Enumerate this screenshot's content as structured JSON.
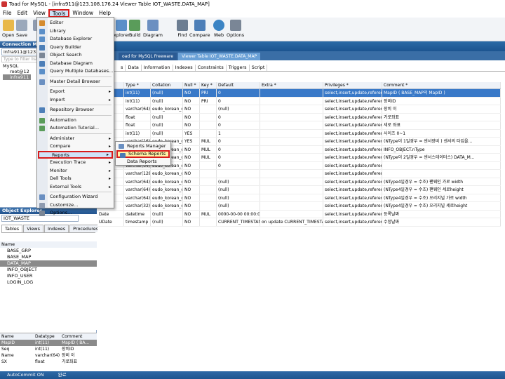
{
  "window": {
    "title": "Toad for MySQL - [infra911@123.108.176.24 Viewer Table IOT_WASTE.DATA_MAP]"
  },
  "menubar": {
    "items": [
      "File",
      "Edit",
      "View",
      "Tools",
      "Window",
      "Help"
    ]
  },
  "toolbar": {
    "buttons": [
      "Open",
      "Save",
      "Pr",
      "xplorer",
      "Build",
      "Diagram",
      "Find",
      "Compare",
      "Web",
      "Options"
    ]
  },
  "connection_manager": {
    "title": "Connection Mana",
    "connection": "infra911@123.108.",
    "filter_placeholder": "Type to filter list",
    "tree": [
      "MySQL",
      "root@12",
      "infra911"
    ]
  },
  "doc_tabs": [
    "oad for MySQL Freeware",
    "Viewer Table IOT_WASTE.DATA_MAP"
  ],
  "sub_tabs": [
    "s",
    "Data",
    "Information",
    "Indexes",
    "Constraints",
    "Triggers",
    "Script"
  ],
  "tools_menu": {
    "items": [
      "Editor",
      "Library",
      "Database Explorer",
      "Query Builder",
      "Object Search",
      "Database Diagram",
      "Query Multiple Databases...",
      "Master Detail Browser",
      "Export",
      "Import",
      "Repository Browser",
      "Automation",
      "Automation Tutorial...",
      "Administer",
      "Compare",
      "Reports",
      "Execution Trace",
      "Monitor",
      "Dell Tools",
      "External Tools",
      "Configuration Wizard",
      "Customize...",
      "Options..."
    ]
  },
  "reports_submenu": {
    "items": [
      "Reports Manager",
      "Schema Reports",
      "Data Reports"
    ]
  },
  "object_explorer": {
    "title": "Object Explorer",
    "schema": "IOT_WASTE",
    "tabs": [
      "Tables",
      "Views",
      "Indexes",
      "Procedures"
    ],
    "list_header": "Name",
    "tables": [
      "BASE_GRP",
      "BASE_MAP",
      "DATA_MAP",
      "INFO_OBJECT",
      "INFO_USER",
      "LOGIN_LOG"
    ]
  },
  "columns_grid": {
    "headers": [
      "Name",
      "Datatype",
      "Comment"
    ],
    "rows": [
      [
        "MapID",
        "int(11)",
        "MapID ( BA..."
      ],
      [
        "Seq",
        "int(11)",
        "장비ID"
      ],
      [
        "Name",
        "varchar(64)",
        "장비 이"
      ],
      [
        "SX",
        "float",
        "가로좌표"
      ]
    ]
  },
  "grid": {
    "headers": [
      "ID *",
      "Type *",
      "Collation",
      "Null *",
      "Key *",
      "Default",
      "Extra *",
      "Privileges *",
      "Comment *"
    ],
    "rows": [
      [
        "D",
        "int(11)",
        "(null)",
        "NO",
        "PRI",
        "0",
        "",
        "select,insert,update,references",
        "MapID ( BASE_MAP의 MapID )"
      ],
      [
        "",
        "int(11)",
        "(null)",
        "NO",
        "PRI",
        "0",
        "",
        "select,insert,update,references",
        "장비ID"
      ],
      [
        "e",
        "varchar(64)",
        "eudo_korean_ci",
        "NO",
        "",
        "(null)",
        "",
        "select,insert,update,references",
        "장비 이"
      ],
      [
        "",
        "float",
        "(null)",
        "NO",
        "",
        "0",
        "",
        "select,insert,update,references",
        "가로좌표"
      ],
      [
        "",
        "float",
        "(null)",
        "NO",
        "",
        "0",
        "",
        "select,insert,update,references",
        "세로 좌표"
      ],
      [
        "",
        "int(11)",
        "(null)",
        "YES",
        "",
        "1",
        "",
        "select,insert,update,references",
        "사이즈 0~1"
      ],
      [
        "e",
        "varchar(16)",
        "eudo_korean_ci",
        "YES",
        "MUL",
        "0",
        "",
        "select,insert,update,references",
        "(NType이 1일경우 = 센서장비 ) 센서의 타입을..."
      ],
      [
        "",
        "varchar(64)",
        "eudo_korean_ci",
        "NO",
        "MUL",
        "0",
        "",
        "select,insert,update,references",
        "INFO_OBJECT.nType"
      ],
      [
        "",
        "varchar(64)",
        "eudo_korean_ci",
        "NO",
        "MUL",
        "0",
        "",
        "select,insert,update,references",
        "(NType이 2일경우 = 센서스테이터스) DATA_M..."
      ],
      [
        "",
        "varchar(64)",
        "eudo_korean_ci",
        "NO",
        "",
        "0",
        "",
        "select,insert,update,references",
        ""
      ],
      [
        "str",
        "varchar(128)",
        "eudo_korean_ci",
        "NO",
        "",
        "",
        "",
        "select,insert,update,references",
        ""
      ],
      [
        "ht1",
        "varchar(64)",
        "eudo_korean_ci",
        "NO",
        "",
        "(null)",
        "",
        "select,insert,update,references",
        "(NType4일경우 = 수조) 팬웨인 가로 width"
      ],
      [
        "ht2",
        "varchar(64)",
        "eudo_korean_ci",
        "NO",
        "",
        "(null)",
        "",
        "select,insert,update,references",
        "(NType4일경우 = 수조) 팬웨인 세로height"
      ],
      [
        "ht3",
        "varchar(64)",
        "eudo_korean_ci",
        "NO",
        "",
        "(null)",
        "",
        "select,insert,update,references",
        "(NType4일경우 = 수조) 오리지널 가로 width"
      ],
      [
        "ht4",
        "varchar(32)",
        "eudo_korean_ci",
        "NO",
        "",
        "(null)",
        "",
        "select,insert,update,references",
        "(NType4일경우 = 수조) 오리지널 세로height"
      ],
      [
        "Date",
        "datetime",
        "(null)",
        "NO",
        "MUL",
        "0000-00-00 00:00:00",
        "",
        "select,insert,update,references",
        "등록날짜"
      ],
      [
        "UDate",
        "timestamp",
        "(null)",
        "NO",
        "",
        "CURRENT_TIMESTAMP",
        "on update CURRENT_TIMESTAMP",
        "select,insert,update,references",
        "수정날짜"
      ]
    ]
  },
  "statusbar": {
    "left": "AutoCommit ON",
    "right": "완료"
  }
}
